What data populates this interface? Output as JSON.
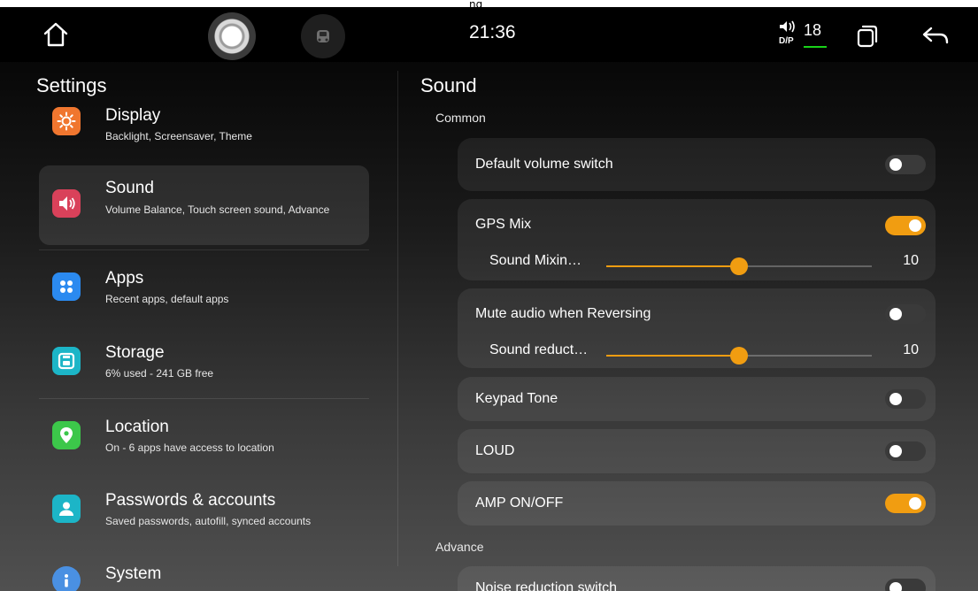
{
  "top_strip": {
    "sliver_text": "ng"
  },
  "status_bar": {
    "time": "21:36",
    "volume_value": "18",
    "icons": {
      "home": "home-icon",
      "bubble": "floating-bubble-icon",
      "car": "car-icon",
      "volume": "dsp-volume-icon",
      "recents": "recents-icon",
      "back": "back-icon"
    }
  },
  "left_panel": {
    "title": "Settings",
    "items": [
      {
        "title": "Display",
        "subtitle": "Backlight, Screensaver, Theme",
        "icon": "brightness-icon",
        "color": "#f0762f"
      },
      {
        "title": "Sound",
        "subtitle": "Volume Balance, Touch screen sound, Advance",
        "icon": "volume-icon",
        "color": "#d9415a",
        "active": true
      },
      {
        "title": "Apps",
        "subtitle": "Recent apps, default apps",
        "icon": "apps-grid-icon",
        "color": "#2b8af0"
      },
      {
        "title": "Storage",
        "subtitle": "6% used - 241 GB free",
        "icon": "storage-icon",
        "color": "#1cb5c7"
      },
      {
        "title": "Location",
        "subtitle": "On - 6 apps have access to location",
        "icon": "location-pin-icon",
        "color": "#3cc74a"
      },
      {
        "title": "Passwords & accounts",
        "subtitle": "Saved passwords, autofill, synced accounts",
        "icon": "account-icon",
        "color": "#1cb5c7"
      },
      {
        "title": "System",
        "subtitle": "",
        "icon": "info-icon",
        "color": "#4a90e2"
      }
    ]
  },
  "right_panel": {
    "title": "Sound",
    "section_common": "Common",
    "section_advance": "Advance",
    "rows": {
      "default_volume": {
        "label": "Default volume switch",
        "on": false
      },
      "gps_mix": {
        "label": "GPS Mix",
        "on": true
      },
      "sound_mixing": {
        "label": "Sound Mixin…",
        "value": "10",
        "fraction": 0.5
      },
      "mute_reversing": {
        "label": "Mute audio when Reversing",
        "on": false
      },
      "sound_reduction": {
        "label": "Sound reduct…",
        "value": "10",
        "fraction": 0.5
      },
      "keypad_tone": {
        "label": "Keypad Tone",
        "on": false
      },
      "loud": {
        "label": "LOUD",
        "on": false
      },
      "amp": {
        "label": "AMP ON/OFF",
        "on": true
      },
      "noise_reduction": {
        "label": "Noise reduction switch",
        "on": false
      }
    }
  },
  "colors": {
    "accent": "#f19d11",
    "toggle_off": "#3a3a3a",
    "volume_line": "#19d219"
  }
}
